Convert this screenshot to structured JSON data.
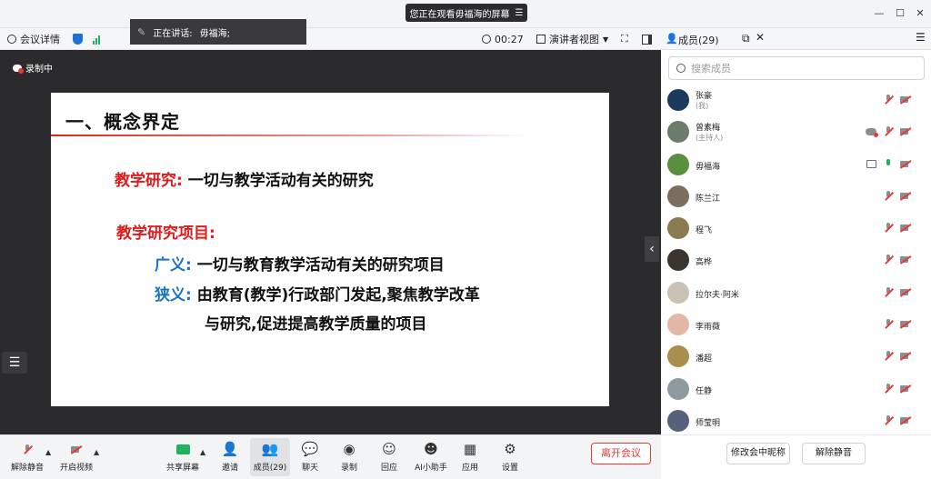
{
  "top": {
    "sharing_notice": "您正在观看毋福海的屏幕",
    "speaking_prefix": "正在讲话:",
    "speaking_name": "毋福海;",
    "meeting_details": "会议详情",
    "duration": "00:27",
    "view_mode": "演讲者视图",
    "members_label": "成员(29)"
  },
  "stage": {
    "recording_label": "录制中",
    "slide": {
      "title": "一、概念界定",
      "term1": "教学研究:",
      "def1": "一切与教学活动有关的研究",
      "term2": "教学研究项目:",
      "broad_label": "广义:",
      "broad_text": "一切与教育教学活动有关的研究项目",
      "narrow_label": "狭义:",
      "narrow_text_1": "由教育(教学)行政部门发起,聚焦教学改革",
      "narrow_text_2": "与研究,促进提高教学质量的项目"
    }
  },
  "toolbar": {
    "unmute": "解除静音",
    "start_video": "开启视频",
    "share_screen": "共享屏幕",
    "invite": "邀请",
    "members": "成员(29)",
    "chat": "聊天",
    "record": "录制",
    "reactions": "回应",
    "ai_assistant": "AI小助手",
    "apps": "应用",
    "settings": "设置",
    "leave": "离开会议"
  },
  "members_panel": {
    "search_placeholder": "搜索成员",
    "rename": "修改会中昵称",
    "unmute": "解除静音",
    "list": [
      {
        "name": "张豪",
        "role": "(我)",
        "avatar": "#1d3a5c",
        "status": [
          "mic-off",
          "cam-off"
        ]
      },
      {
        "name": "曾素梅",
        "role": "(主持人)",
        "avatar": "#6b7c6a",
        "status": [
          "cloud",
          "mic-off",
          "cam-off"
        ]
      },
      {
        "name": "毋福海",
        "role": "",
        "avatar": "#5a8f3e",
        "status": [
          "screen",
          "mic-on",
          "cam-off"
        ]
      },
      {
        "name": "陈兰江",
        "role": "",
        "avatar": "#7a6e5f",
        "status": [
          "mic-off",
          "cam-off"
        ]
      },
      {
        "name": "程飞",
        "role": "",
        "avatar": "#8c7a52",
        "status": [
          "mic-off",
          "cam-off"
        ]
      },
      {
        "name": "高桦",
        "role": "",
        "avatar": "#3b3530",
        "status": [
          "mic-off",
          "cam-off"
        ]
      },
      {
        "name": "拉尔夫·阿米",
        "role": "",
        "avatar": "#c9c2b5",
        "status": [
          "mic-off",
          "cam-off"
        ]
      },
      {
        "name": "李雨薇",
        "role": "",
        "avatar": "#e3b7a7",
        "status": [
          "mic-off",
          "cam-off"
        ]
      },
      {
        "name": "潘超",
        "role": "",
        "avatar": "#a88f4e",
        "status": [
          "mic-off",
          "cam-off"
        ]
      },
      {
        "name": "任静",
        "role": "",
        "avatar": "#8d9aa0",
        "status": [
          "mic-off",
          "cam-off"
        ]
      },
      {
        "name": "师莹明",
        "role": "",
        "avatar": "#55627a",
        "status": [
          "mic-off",
          "cam-off"
        ]
      }
    ]
  },
  "colors": {
    "accent_red": "#e53935",
    "slide_red": "#e01b1b",
    "slide_blue": "#1d73c3",
    "mic_on_green": "#20b25c"
  }
}
